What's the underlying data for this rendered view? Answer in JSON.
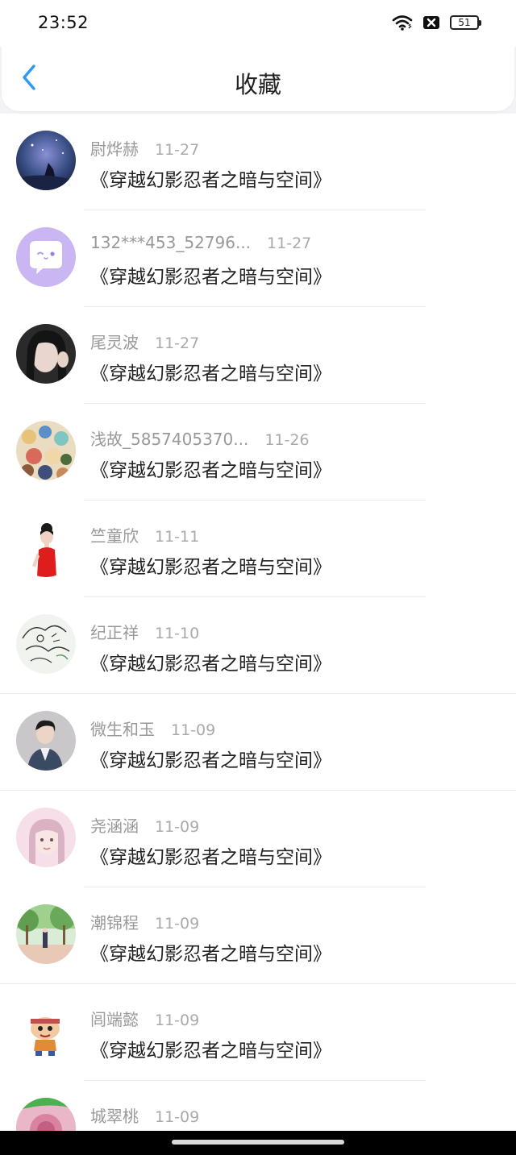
{
  "status_bar": {
    "time": "23:52",
    "battery": "51",
    "icons": [
      "wifi-icon",
      "sim-off-icon",
      "battery-icon"
    ]
  },
  "header": {
    "title": "收藏",
    "back_icon": "chevron-left-icon",
    "accent_color": "#2f9bf0"
  },
  "favorites": [
    {
      "name": "尉烨赫",
      "date": "11-27",
      "title": "《穿越幻影忍者之暗与空间》",
      "avatar": "avatar-fantasy-night"
    },
    {
      "name": "132***453_52796...",
      "date": "11-27",
      "title": "《穿越幻影忍者之暗与空间》",
      "avatar": "avatar-default-chat"
    },
    {
      "name": "尾灵波",
      "date": "11-27",
      "title": "《穿越幻影忍者之暗与空间》",
      "avatar": "avatar-girl-photo"
    },
    {
      "name": "浅故_5857405370...",
      "date": "11-26",
      "title": "《穿越幻影忍者之暗与空间》",
      "avatar": "avatar-anime-group"
    },
    {
      "name": "竺童欣",
      "date": "11-11",
      "title": "《穿越幻影忍者之暗与空间》",
      "avatar": "avatar-woman-red"
    },
    {
      "name": "纪正祥",
      "date": "11-10",
      "title": "《穿越幻影忍者之暗与空间》",
      "avatar": "avatar-sketch"
    },
    {
      "name": "微生和玉",
      "date": "11-09",
      "title": "《穿越幻影忍者之暗与空间》",
      "avatar": "avatar-young-man"
    },
    {
      "name": "尧涵涵",
      "date": "11-09",
      "title": "《穿越幻影忍者之暗与空间》",
      "avatar": "avatar-pink-girl"
    },
    {
      "name": "潮锦程",
      "date": "11-09",
      "title": "《穿越幻影忍者之暗与空间》",
      "avatar": "avatar-park"
    },
    {
      "name": "闾端懿",
      "date": "11-09",
      "title": "《穿越幻影忍者之暗与空间》",
      "avatar": "avatar-cartoon"
    },
    {
      "name": "城翠桃",
      "date": "11-09",
      "title": "",
      "avatar": "avatar-flower"
    }
  ]
}
